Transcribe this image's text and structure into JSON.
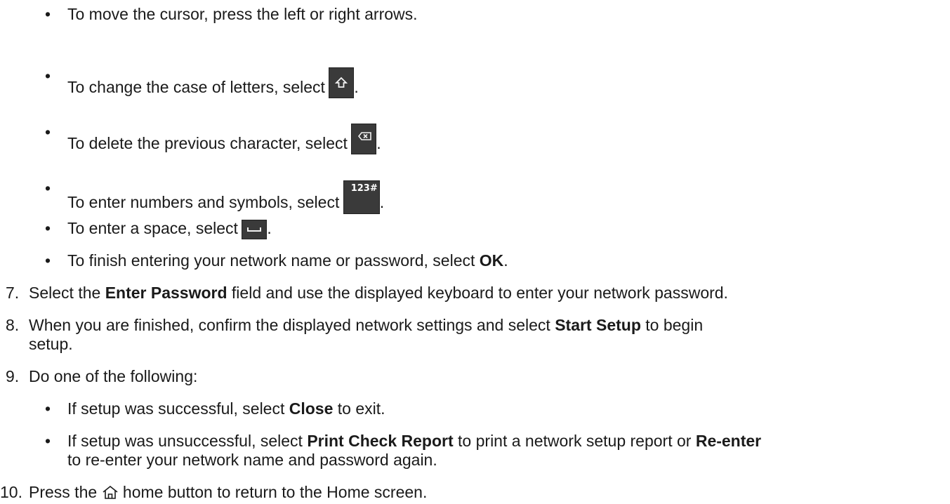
{
  "bullets_keyboard": [
    {
      "text": "To move the cursor, press the left or right arrows."
    },
    {
      "pre": "To change the case of letters, select ",
      "post": ".",
      "icon": "shift-key-icon"
    },
    {
      "pre": "To delete the previous character, select ",
      "post": ".",
      "icon": "backspace-key-icon"
    },
    {
      "pre": "To enter numbers and symbols, select ",
      "post": ".",
      "icon": "numbers-symbols-key-icon",
      "icon_label": "123#"
    },
    {
      "pre": "To enter a space, select ",
      "post": ".",
      "icon": "space-key-icon"
    },
    {
      "pre": "To finish entering your network name or password, select ",
      "bold": "OK",
      "post": "."
    }
  ],
  "steps": [
    {
      "num": "7.",
      "pre": "Select the ",
      "bold": "Enter Password",
      "post": " field and use the displayed keyboard to enter your network password."
    },
    {
      "num": "8.",
      "pre": "When you are finished, confirm the displayed network settings and select ",
      "bold": "Start Setup",
      "post": " to begin",
      "cont": "setup."
    },
    {
      "num": "9.",
      "text": "Do one of the following:"
    },
    {
      "num": "10.",
      "pre": "Press the ",
      "post": " home button to return to the Home screen.",
      "icon": "home-icon"
    }
  ],
  "bullets_result": [
    {
      "pre": "If setup was successful, select ",
      "bold": "Close",
      "post": " to exit."
    },
    {
      "pre": "If setup was unsuccessful, select ",
      "bold": "Print Check Report",
      "mid": " to print a network setup report or ",
      "bold2": "Re-enter",
      "cont": "to re-enter your network name and password again."
    }
  ],
  "bullet_char": "•"
}
